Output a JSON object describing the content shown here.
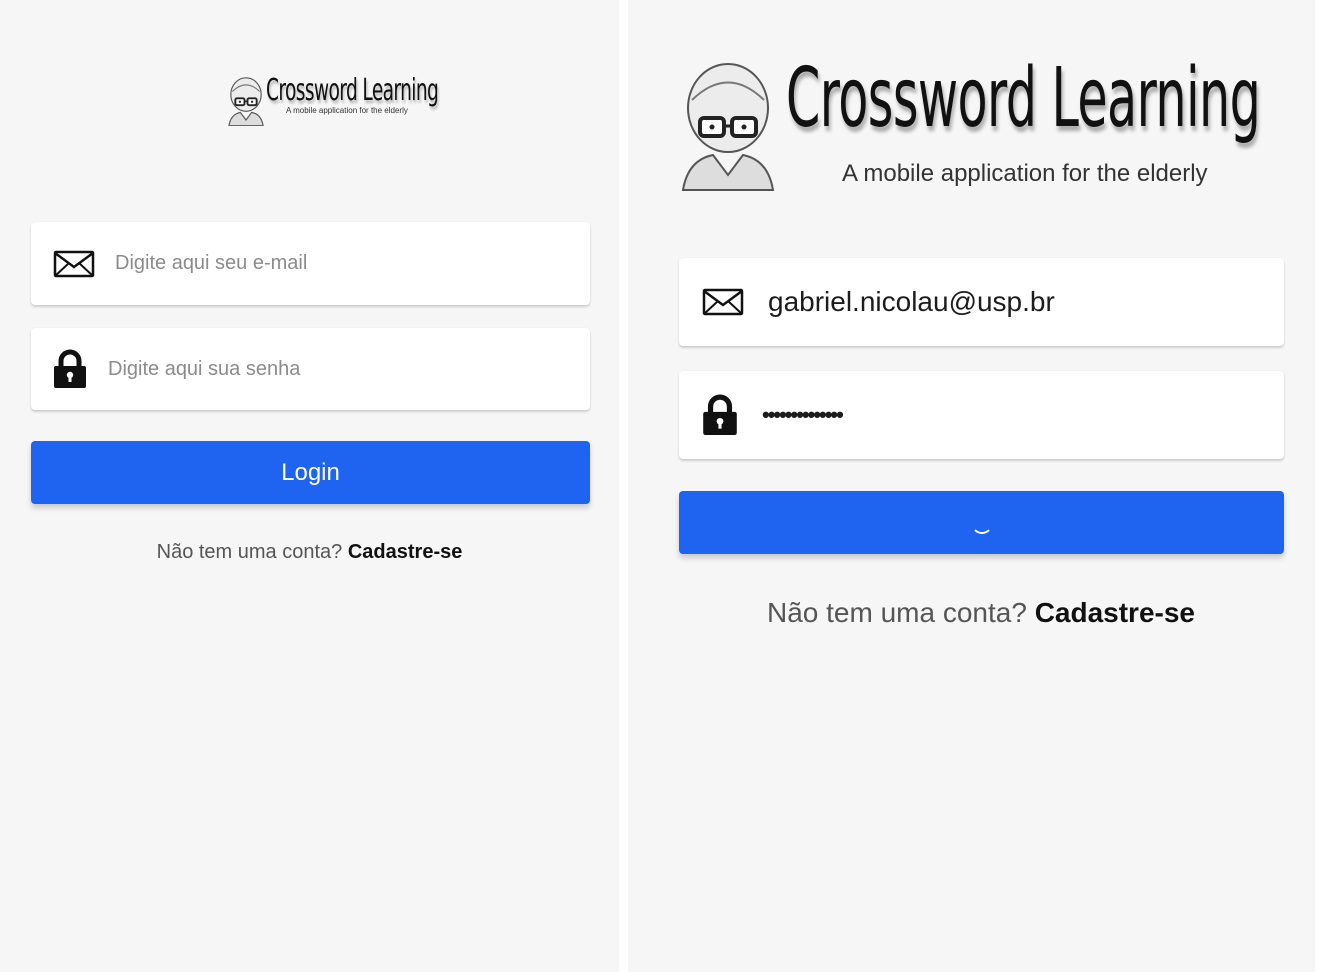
{
  "logo": {
    "title": "Crossword Learning",
    "subtitle": "A mobile application for the elderly"
  },
  "left_screen": {
    "email_placeholder": "Digite aqui seu e-mail",
    "password_placeholder": "Digite aqui sua senha",
    "login_label": "Login",
    "signup_prompt": "Não tem uma conta?",
    "signup_link": "Cadastre-se"
  },
  "right_screen": {
    "email_value": "gabriel.nicolau@usp.br",
    "password_masked": "••••••••••••••",
    "button_state": "loading",
    "signup_prompt": "Não tem uma conta?",
    "signup_link": "Cadastre-se"
  },
  "colors": {
    "background": "#f6f6f6",
    "button": "#1e64f0"
  },
  "icons": [
    "envelope-icon",
    "lock-icon",
    "loading-spinner-icon",
    "elderly-face-logo-icon"
  ]
}
